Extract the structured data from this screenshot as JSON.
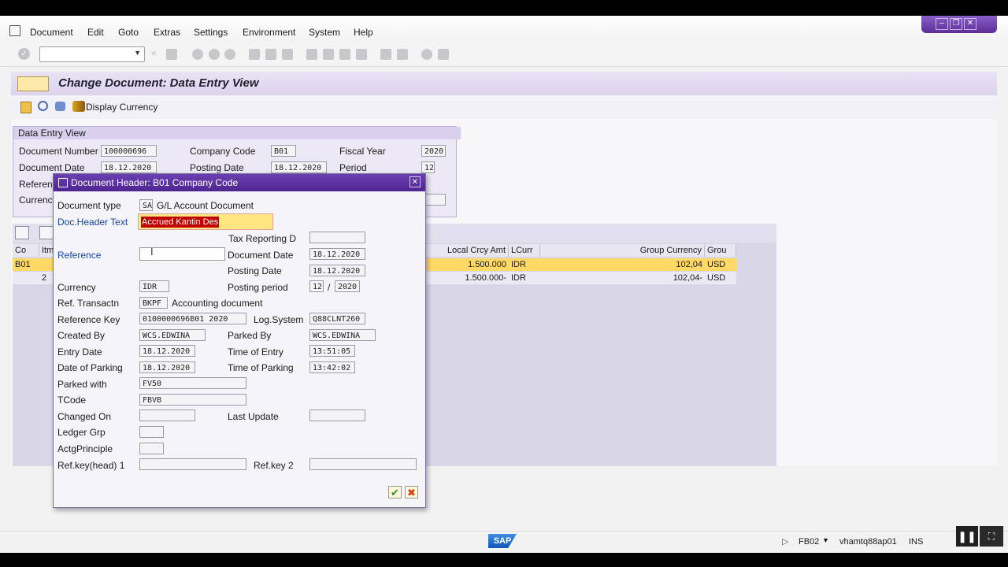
{
  "menu": {
    "items": [
      "Document",
      "Edit",
      "Goto",
      "Extras",
      "Settings",
      "Environment",
      "System",
      "Help"
    ]
  },
  "page": {
    "title": "Change Document: Data Entry View",
    "display_currency": "Display Currency"
  },
  "data_entry": {
    "group_title": "Data Entry View",
    "doc_number_label": "Document Number",
    "doc_number": "100000696",
    "company_code_label": "Company Code",
    "company_code": "B01",
    "fiscal_year_label": "Fiscal Year",
    "fiscal_year": "2020",
    "doc_date_label": "Document Date",
    "doc_date": "18.12.2020",
    "posting_date_label": "Posting Date",
    "posting_date": "18.12.2020",
    "period_label": "Period",
    "period": "12",
    "reference_label": "Referenc",
    "currency_label": "Currency"
  },
  "grid": {
    "headers": [
      "Co",
      "Itm",
      "Local Crcy Amt",
      "LCurr",
      "Group Currency",
      "Grou"
    ],
    "rows": [
      {
        "co": "B01",
        "itm": "",
        "local_amt": "1.500.000",
        "lcurr": "IDR",
        "group_amt": "102,04",
        "grp_curr": "USD"
      },
      {
        "co": "",
        "itm": "2",
        "local_amt": "1.500.000-",
        "lcurr": "IDR",
        "group_amt": "102,04-",
        "grp_curr": "USD"
      }
    ]
  },
  "dialog": {
    "title": "Document Header: B01 Company Code",
    "doc_type_label": "Document type",
    "doc_type": "SA",
    "doc_type_desc": "G/L Account Document",
    "header_text_label": "Doc.Header Text",
    "header_text": "Accrued Kantin Des",
    "tax_reporting_label": "Tax Reporting D",
    "tax_reporting": "",
    "reference_label": "Reference",
    "reference": "",
    "doc_date_label": "Document Date",
    "doc_date": "18.12.2020",
    "posting_date_label": "Posting Date",
    "posting_date": "18.12.2020",
    "currency_label": "Currency",
    "currency": "IDR",
    "posting_period_label": "Posting period",
    "posting_period": "12",
    "period_sep": "/",
    "posting_year": "2020",
    "ref_trans_label": "Ref. Transactn",
    "ref_trans": "BKPF",
    "ref_trans_desc": "Accounting document",
    "ref_key_label": "Reference Key",
    "ref_key": "0100000696B01 2020",
    "log_system_label": "Log.System",
    "log_system": "Q88CLNT260",
    "created_by_label": "Created By",
    "created_by": "WCS.EDWINA",
    "parked_by_label": "Parked By",
    "parked_by": "WCS.EDWINA",
    "entry_date_label": "Entry Date",
    "entry_date": "18.12.2020",
    "time_entry_label": "Time of Entry",
    "time_entry": "13:51:05",
    "date_parking_label": "Date of Parking",
    "date_parking": "18.12.2020",
    "time_parking_label": "Time of Parking",
    "time_parking": "13:42:02",
    "parked_with_label": "Parked with",
    "parked_with": "FV50",
    "tcode_label": "TCode",
    "tcode": "FBVB",
    "changed_on_label": "Changed On",
    "changed_on": "",
    "last_update_label": "Last Update",
    "last_update": "",
    "ledger_grp_label": "Ledger Grp",
    "ledger_grp": "",
    "actg_principle_label": "ActgPrinciple",
    "actg_principle": "",
    "refkey_head1_label": "Ref.key(head) 1",
    "refkey_head1": "",
    "refkey2_label": "Ref.key 2",
    "refkey2": ""
  },
  "status": {
    "tcode": "FB02",
    "server": "vhamtq88ap01",
    "mode": "INS",
    "logo": "SAP"
  },
  "colors": {
    "accent": "#5b2f96",
    "selected_row": "#ffd966",
    "highlight_field": "#ffe680",
    "selection": "#c00000"
  }
}
